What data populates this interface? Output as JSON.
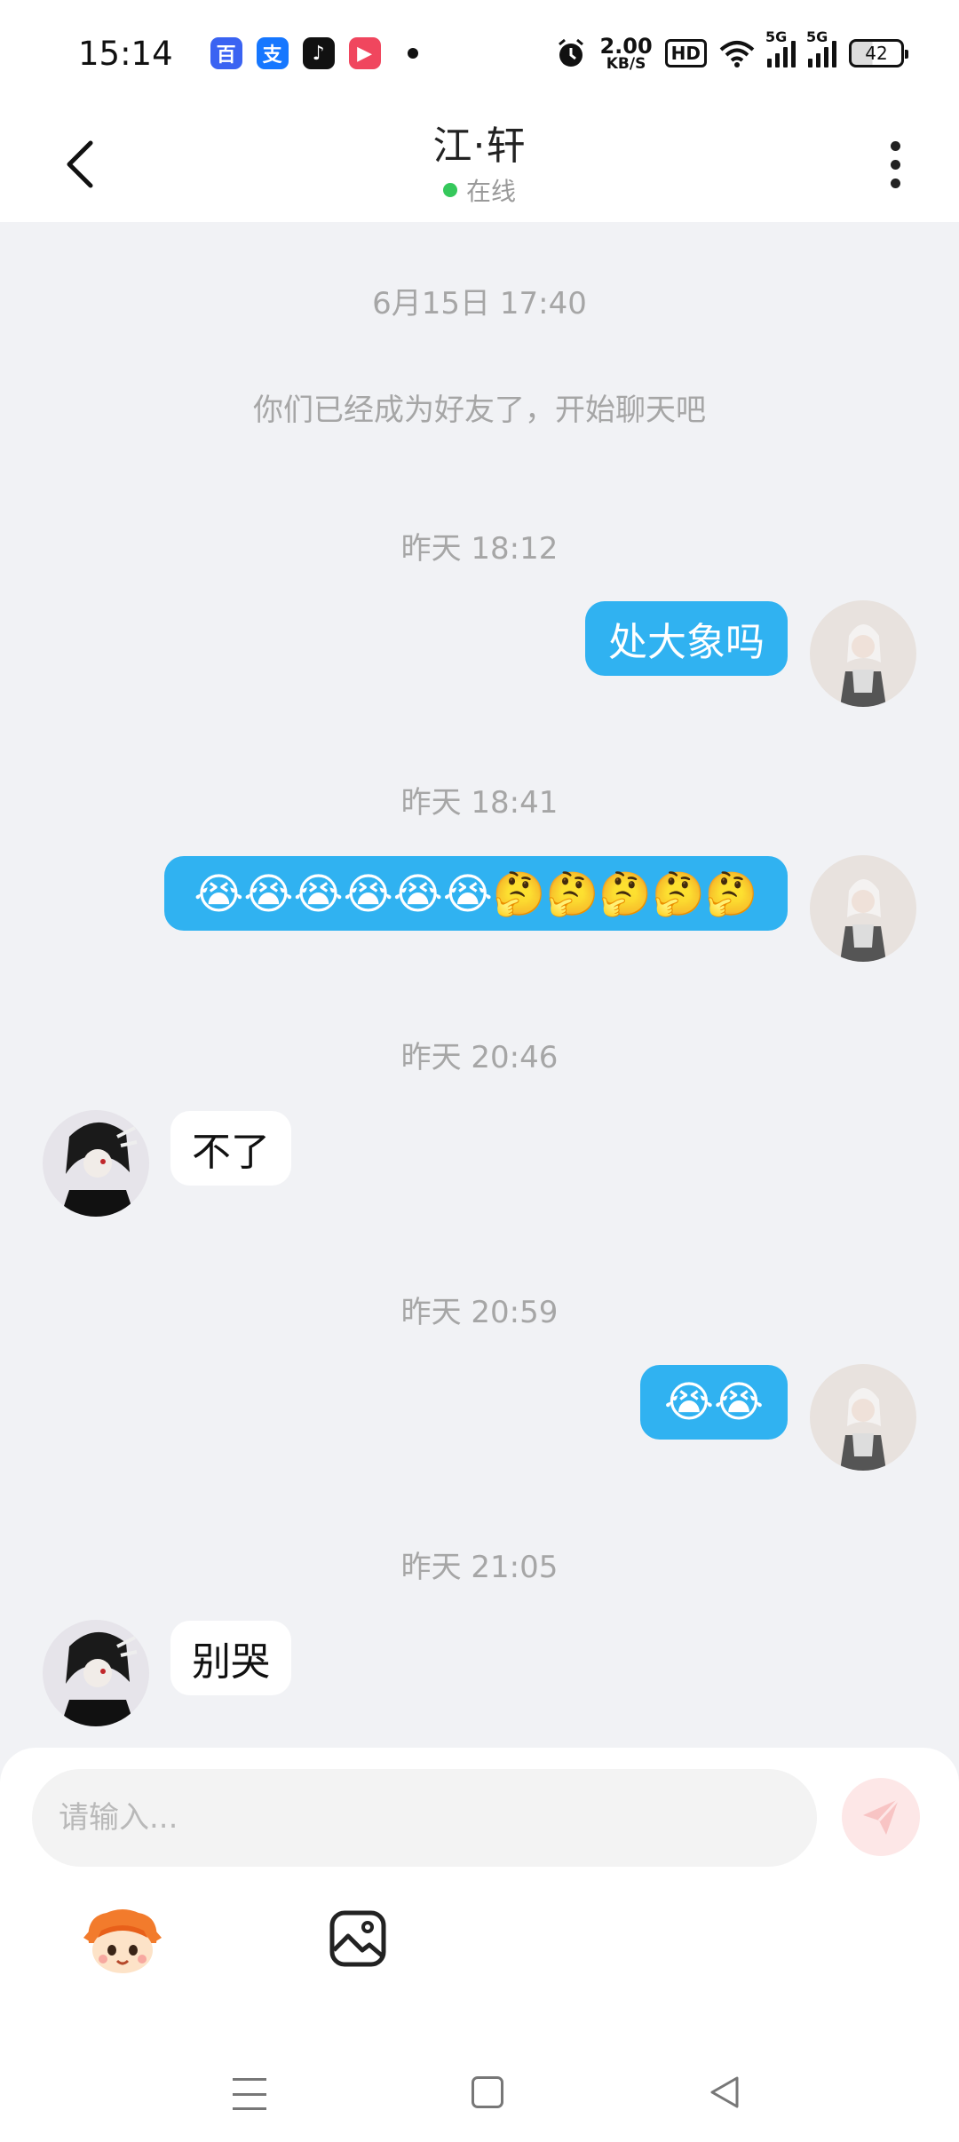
{
  "status_bar": {
    "time": "15:14",
    "apps": [
      {
        "icon": "baidu-icon",
        "glyph": "百",
        "color": "#3a63f2"
      },
      {
        "icon": "alipay-icon",
        "glyph": "支",
        "color": "#1677ff"
      },
      {
        "icon": "tiktok-icon",
        "glyph": "♪",
        "color": "#111111"
      },
      {
        "icon": "video-app-icon",
        "glyph": "▶",
        "color": "#f0465e"
      }
    ],
    "net_speed_value": "2.00",
    "net_speed_unit": "KB/S",
    "hd_label": "HD",
    "signal_label_1": "5G",
    "signal_label_2": "5G",
    "battery": "42"
  },
  "header": {
    "contact_name": "江·轩",
    "online_status": "在线",
    "online_color": "#35c85b"
  },
  "messages": {
    "ts1": "6月15日 17:40",
    "system_note": "你们已经成为好友了，开始聊天吧",
    "ts2": "昨天 18:12",
    "msg1": "处大象吗",
    "ts3": "昨天 18:41",
    "msg2": "😭😭😭😭😭😭🤔🤔🤔🤔🤔",
    "ts4": "昨天 20:46",
    "msg3": "不了",
    "ts5": "昨天 20:59",
    "msg4": "😭😭",
    "ts6": "昨天 21:05",
    "msg5": "别哭"
  },
  "input": {
    "placeholder": "请输入..."
  },
  "colors": {
    "outgoing_bubble": "#30b2f1",
    "background": "#f1f2f5"
  }
}
